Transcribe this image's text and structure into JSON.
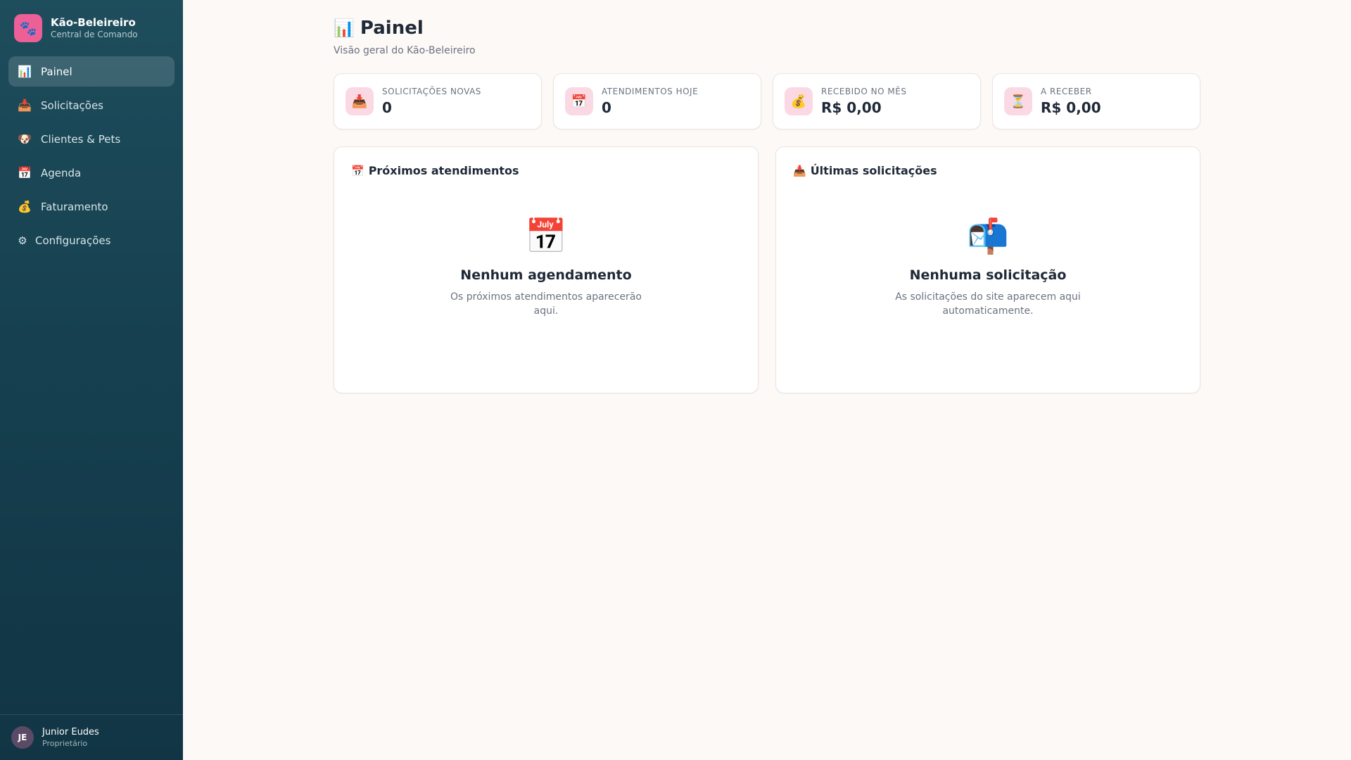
{
  "brand": {
    "icon": "paw-icon",
    "logo_glyph": "🐾",
    "name": "Kão-Beleireiro",
    "subtitle": "Central de Comando",
    "accent": "#ec5f97"
  },
  "sidebar": {
    "items": [
      {
        "icon": "chart-icon",
        "glyph": "📊",
        "label": "Painel",
        "active": true
      },
      {
        "icon": "inbox-icon",
        "glyph": "📥",
        "label": "Solicitações"
      },
      {
        "icon": "dog-icon",
        "glyph": "🐶",
        "label": "Clientes & Pets"
      },
      {
        "icon": "calendar-icon",
        "glyph": "📅",
        "label": "Agenda"
      },
      {
        "icon": "money-bag-icon",
        "glyph": "💰",
        "label": "Faturamento"
      },
      {
        "icon": "gear-icon",
        "glyph": "⚙",
        "label": "Configurações"
      }
    ]
  },
  "user": {
    "initials": "JE",
    "name": "Junior Eudes",
    "role": "Proprietário"
  },
  "page": {
    "icon_glyph": "📊",
    "title": "Painel",
    "subtitle": "Visão geral do Kão-Beleireiro"
  },
  "stats": [
    {
      "icon": "inbox-icon",
      "glyph": "📥",
      "label": "Solicitações novas",
      "value": "0"
    },
    {
      "icon": "calendar-icon",
      "glyph": "📅",
      "label": "Atendimentos hoje",
      "value": "0"
    },
    {
      "icon": "money-bag-icon",
      "glyph": "💰",
      "label": "Recebido no mês",
      "value": "R$ 0,00"
    },
    {
      "icon": "hourglass-icon",
      "glyph": "⏳",
      "label": "A receber",
      "value": "R$ 0,00"
    }
  ],
  "panels": {
    "upcoming": {
      "title_glyph": "📅",
      "title": "Próximos atendimentos",
      "empty_glyph": "📅",
      "empty_title": "Nenhum agendamento",
      "empty_text": "Os próximos atendimentos aparecerão aqui."
    },
    "requests": {
      "title_glyph": "📥",
      "title": "Últimas solicitações",
      "empty_glyph": "📬",
      "empty_title": "Nenhuma solicitação",
      "empty_text": "As solicitações do site aparecem aqui automaticamente."
    }
  }
}
